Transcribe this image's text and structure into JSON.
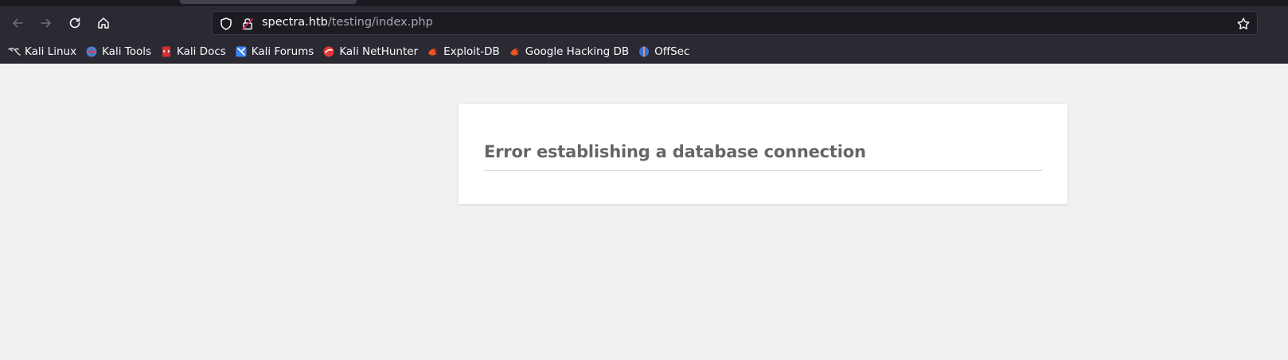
{
  "browser": {
    "address_bar": {
      "host": "spectra.htb",
      "path": "/testing/index.php"
    },
    "nav_buttons": [
      "back-icon",
      "forward-icon",
      "reload-icon",
      "home-icon"
    ],
    "bookmarks": [
      {
        "label": "Kali Linux",
        "icon": "kali-dragon-icon",
        "color": "#cccccc"
      },
      {
        "label": "Kali Tools",
        "icon": "kali-tools-icon",
        "color": "#4a7fd4"
      },
      {
        "label": "Kali Docs",
        "icon": "kali-docs-icon",
        "color": "#d32f2f"
      },
      {
        "label": "Kali Forums",
        "icon": "kali-forums-icon",
        "color": "#3b82f6"
      },
      {
        "label": "Kali NetHunter",
        "icon": "kali-nethunter-icon",
        "color": "#e53935"
      },
      {
        "label": "Exploit-DB",
        "icon": "exploit-db-icon",
        "color": "#f4511e"
      },
      {
        "label": "Google Hacking DB",
        "icon": "ghdb-icon",
        "color": "#f4511e"
      },
      {
        "label": "OffSec",
        "icon": "offsec-icon",
        "color": "#3f6fd1"
      }
    ]
  },
  "page": {
    "error_message": "Error establishing a database connection"
  }
}
